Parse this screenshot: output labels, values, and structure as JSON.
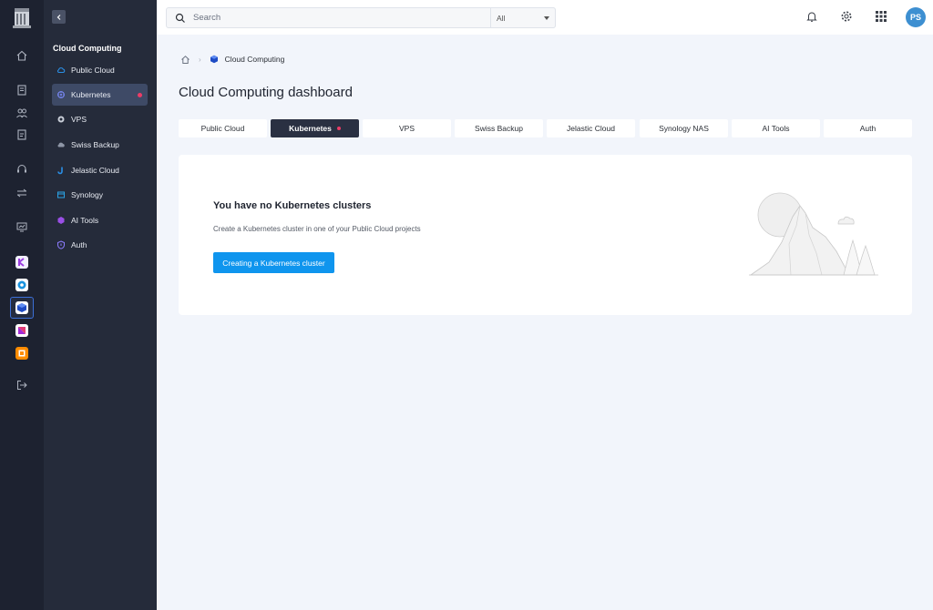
{
  "topbar": {
    "search_placeholder": "Search",
    "filter_value": "All",
    "avatar_initials": "PS",
    "avatar_color": "#3d8fd1",
    "icons": [
      "bell-icon",
      "gear-icon",
      "apps-grid-icon"
    ]
  },
  "sidebar": {
    "section_title": "Cloud Computing",
    "items": [
      {
        "label": "Public Cloud",
        "icon": "cloud-icon"
      },
      {
        "label": "Kubernetes",
        "icon": "kubernetes-icon",
        "active": true,
        "indicator": true
      },
      {
        "label": "VPS",
        "icon": "vps-icon"
      },
      {
        "label": "Swiss Backup",
        "icon": "backup-cloud-icon"
      },
      {
        "label": "Jelastic Cloud",
        "icon": "jelastic-icon"
      },
      {
        "label": "Synology",
        "icon": "synology-icon"
      },
      {
        "label": "AI Tools",
        "icon": "ai-tools-icon"
      },
      {
        "label": "Auth",
        "icon": "shield-icon"
      }
    ]
  },
  "breadcrumb": {
    "current": "Cloud Computing"
  },
  "page": {
    "title": "Cloud Computing dashboard"
  },
  "tabs": [
    {
      "label": "Public Cloud"
    },
    {
      "label": "Kubernetes",
      "active": true,
      "indicator": true
    },
    {
      "label": "VPS"
    },
    {
      "label": "Swiss Backup"
    },
    {
      "label": "Jelastic Cloud"
    },
    {
      "label": "Synology NAS"
    },
    {
      "label": "AI Tools"
    },
    {
      "label": "Auth"
    }
  ],
  "empty_state": {
    "title": "You have no Kubernetes clusters",
    "description": "Create a Kubernetes cluster in one of your Public Cloud projects",
    "button_label": "Creating a Kubernetes cluster"
  },
  "colors": {
    "accent": "#0f95ee",
    "indicator": "#ec3c66",
    "sidebar_bg": "#252b3a",
    "rail_bg": "#1d2230"
  }
}
